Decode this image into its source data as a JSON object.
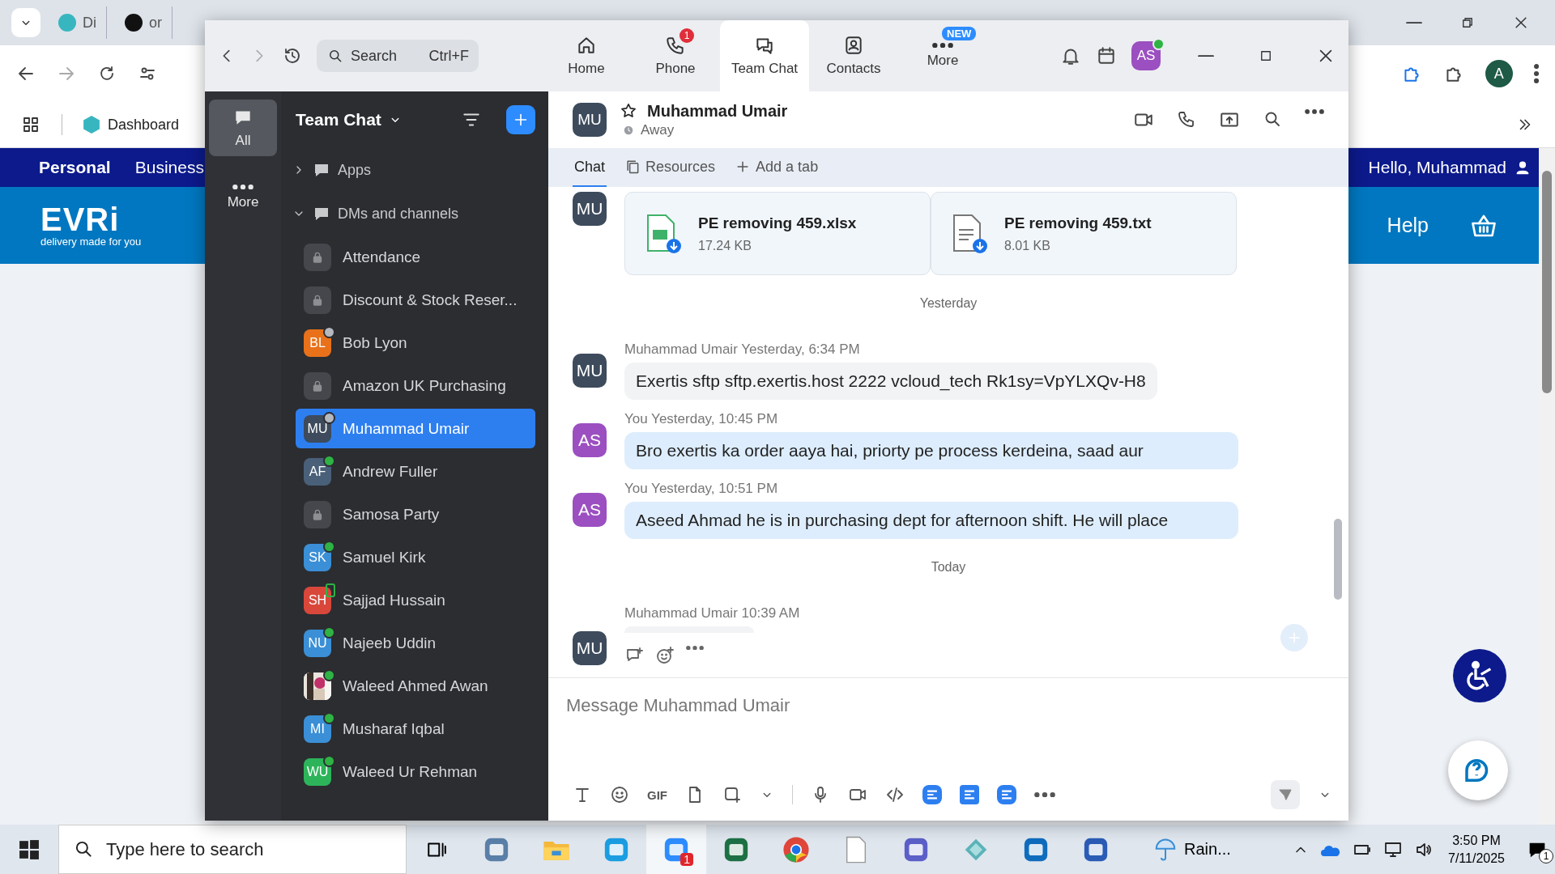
{
  "browser": {
    "tabs": [
      {
        "label": "Di",
        "selected": false
      },
      {
        "label": "or",
        "selected": false
      }
    ],
    "bookmarks": [
      {
        "label": "Dashboard"
      }
    ],
    "profile": "A"
  },
  "site": {
    "nav": [
      {
        "label": "Personal",
        "selected": true
      },
      {
        "label": "Business",
        "selected": false
      }
    ],
    "greeting": "Hello, Muhammad",
    "logo": "EVRi",
    "tagline": "delivery made for you",
    "help": "Help"
  },
  "zoom": {
    "search": {
      "placeholder": "Search",
      "shortcut": "Ctrl+F"
    },
    "nav": [
      {
        "label": "Home",
        "selected": false
      },
      {
        "label": "Phone",
        "badge": "1",
        "selected": false
      },
      {
        "label": "Team Chat",
        "selected": true
      },
      {
        "label": "Contacts",
        "selected": false
      },
      {
        "label": "More",
        "tag": "NEW",
        "selected": false
      }
    ],
    "user_avatar": "AS",
    "rail": [
      {
        "label": "All",
        "selected": true
      },
      {
        "label": "More",
        "selected": false
      }
    ],
    "list": {
      "title": "Team Chat",
      "sections": [
        {
          "label": "Apps",
          "expanded": false
        },
        {
          "label": "DMs and channels",
          "expanded": true,
          "items": [
            {
              "name": "Attendance",
              "kind": "channel",
              "selected": false
            },
            {
              "name": "Discount & Stock Reser...",
              "kind": "channel",
              "selected": false
            },
            {
              "name": "Bob Lyon",
              "kind": "person",
              "initials": "BL",
              "color": "#e8711a",
              "online": false,
              "mobile": false,
              "selected": false
            },
            {
              "name": "Amazon UK Purchasing",
              "kind": "channel",
              "selected": false
            },
            {
              "name": "Muhammad Umair",
              "kind": "person",
              "initials": "MU",
              "color": "#3d4b5c",
              "online": false,
              "mobile": false,
              "selected": true
            },
            {
              "name": "Andrew Fuller",
              "kind": "person",
              "initials": "AF",
              "color": "#4a6079",
              "online": true,
              "mobile": false,
              "selected": false
            },
            {
              "name": "Samosa Party",
              "kind": "channel",
              "selected": false
            },
            {
              "name": "Samuel Kirk",
              "kind": "person",
              "initials": "SK",
              "color": "#3b8fd6",
              "online": true,
              "mobile": false,
              "selected": false
            },
            {
              "name": "Sajjad Hussain",
              "kind": "person",
              "initials": "SH",
              "color": "#d9473b",
              "online": true,
              "mobile": true,
              "selected": false
            },
            {
              "name": "Najeeb Uddin",
              "kind": "person",
              "initials": "NU",
              "color": "#3b8fd6",
              "online": true,
              "mobile": false,
              "selected": false
            },
            {
              "name": "Waleed Ahmed Awan",
              "online": true,
              "mobile": false,
              "selected": false
            },
            {
              "name": "Musharaf Iqbal",
              "kind": "person",
              "initials": "MI",
              "color": "#3b8fd6",
              "online": true,
              "mobile": false,
              "selected": false
            },
            {
              "name": "Waleed Ur Rehman",
              "kind": "person",
              "initials": "WU",
              "color": "#2db45a",
              "online": true,
              "mobile": false,
              "selected": false
            }
          ]
        }
      ]
    },
    "chat": {
      "name": "Muhammad Umair",
      "status": "Away",
      "avatar": "MU",
      "tabs": [
        {
          "label": "Chat",
          "selected": true
        },
        {
          "label": "Resources",
          "selected": false
        },
        {
          "label": "Add a tab",
          "selected": false
        }
      ],
      "messages": [
        {
          "kind": "files",
          "avatar": "MU",
          "color": "#3d4b5c",
          "files": [
            {
              "name": "PE removing 459.xlsx",
              "size": "17.24 KB",
              "kind": "sheet"
            },
            {
              "name": "PE removing 459.txt",
              "size": "8.01 KB",
              "kind": "text"
            }
          ]
        },
        {
          "kind": "divider",
          "label": "Yesterday"
        },
        {
          "kind": "text",
          "sender": "Muhammad Umair",
          "time": "Yesterday, 6:34 PM",
          "avatar": "MU",
          "color": "#3d4b5c",
          "mine": false,
          "text": "Exertis sftp sftp.exertis.host 2222 vcloud_tech Rk1sy=VpYLXQv-H8"
        },
        {
          "kind": "text",
          "sender": "You",
          "time": "Yesterday, 10:45 PM",
          "avatar": "AS",
          "color": "#9b4fc0",
          "mine": true,
          "text": "Bro exertis ka order aaya hai, priorty pe process kerdeina, saad aur"
        },
        {
          "kind": "text",
          "sender": "You",
          "time": "Yesterday, 10:51 PM",
          "avatar": "AS",
          "color": "#9b4fc0",
          "mine": true,
          "text": "Aseed Ahmad he is in purchasing dept for afternoon shift. He will place"
        },
        {
          "kind": "divider",
          "label": "Today"
        },
        {
          "kind": "stub",
          "sender": "Muhammad Umair",
          "time": "10:39 AM",
          "avatar": "MU",
          "color": "#3d4b5c"
        }
      ]
    },
    "composer": {
      "placeholder": "Message Muhammad Umair",
      "tools": [
        {
          "kind": "format"
        },
        {
          "kind": "emoji"
        },
        {
          "kind": "gif",
          "label": "GIF"
        },
        {
          "kind": "file"
        },
        {
          "kind": "screenshot"
        },
        {
          "kind": "caret"
        },
        {
          "kind": "separator"
        },
        {
          "kind": "mic"
        },
        {
          "kind": "video"
        },
        {
          "kind": "code"
        },
        {
          "kind": "app"
        },
        {
          "kind": "app"
        },
        {
          "kind": "app"
        },
        {
          "kind": "more"
        }
      ]
    }
  },
  "taskbar": {
    "search": {
      "placeholder": "Type here to search"
    },
    "apps": [
      {
        "kind": "taskview"
      },
      {
        "kind": "calculator"
      },
      {
        "kind": "folder"
      },
      {
        "kind": "edge"
      },
      {
        "kind": "zoom",
        "badge": "1",
        "selected": true
      },
      {
        "kind": "excel"
      },
      {
        "kind": "chrome"
      },
      {
        "kind": "document"
      },
      {
        "kind": "teams"
      },
      {
        "kind": "gem"
      },
      {
        "kind": "outlook"
      },
      {
        "kind": "word"
      }
    ],
    "weather": "Rain...",
    "time": "3:50 PM",
    "date": "7/11/2025",
    "notifications": "1"
  }
}
